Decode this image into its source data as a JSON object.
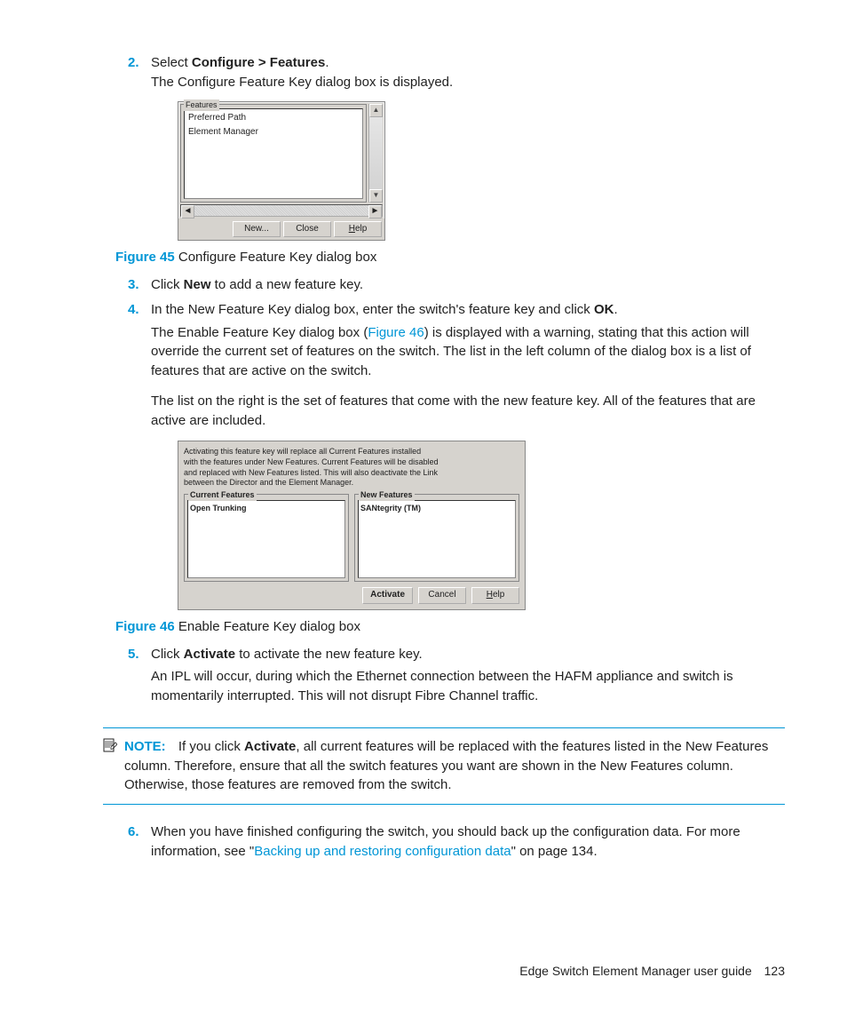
{
  "steps": {
    "s2": {
      "num": "2.",
      "line1_pre": "Select ",
      "line1_bold": "Configure > Features",
      "line1_post": ".",
      "line2": "The Configure Feature Key dialog box is displayed."
    },
    "s3": {
      "num": "3.",
      "pre": "Click ",
      "bold": "New",
      "post": " to add a new feature key."
    },
    "s4": {
      "num": "4.",
      "line1_pre": "In the New Feature Key dialog box, enter the switch's feature key and click ",
      "line1_bold": "OK",
      "line1_post": ".",
      "p1_pre": "The Enable Feature Key dialog box (",
      "p1_link": "Figure 46",
      "p1_post": ") is displayed with a warning, stating that this action will override the current set of features on the switch. The list in the left column of the dialog box is a list of features that are active on the switch.",
      "p2": "The list on the right is the set of features that come with the new feature key. All of the features that are active are included."
    },
    "s5": {
      "num": "5.",
      "line1_pre": "Click ",
      "line1_bold": "Activate",
      "line1_post": " to activate the new feature key.",
      "p1": "An IPL will occur, during which the Ethernet connection between the HAFM appliance and switch is momentarily interrupted. This will not disrupt Fibre Channel traffic."
    },
    "s6": {
      "num": "6.",
      "pre": "When you have finished configuring the switch, you should back up the configuration data. For more information, see \"",
      "link": "Backing up and restoring configuration data",
      "post": "\" on page 134."
    }
  },
  "figures": {
    "f45": {
      "label": "Figure 45",
      "caption": " Configure Feature Key dialog box"
    },
    "f46": {
      "label": "Figure 46",
      "caption": " Enable Feature Key dialog box"
    }
  },
  "dialog1": {
    "legend": "Features",
    "items": [
      "Preferred Path",
      "Element Manager"
    ],
    "buttons": {
      "new": "New...",
      "close": "Close",
      "help_pre": "H",
      "help_rest": "elp"
    }
  },
  "dialog2": {
    "warn1": "Activating this feature key will replace all Current Features installed",
    "warn2": "with the features under New Features. Current Features will be disabled",
    "warn3": "and replaced with New Features listed. This will also deactivate the Link",
    "warn4": "between the Director and the Element Manager.",
    "left_legend": "Current Features",
    "right_legend": "New Features",
    "left_item": "Open Trunking",
    "right_item": "SANtegrity (TM)",
    "buttons": {
      "activate": "Activate",
      "cancel": "Cancel",
      "help_pre": "H",
      "help_rest": "elp"
    }
  },
  "note": {
    "label": "NOTE:",
    "pre": "If you click ",
    "bold": "Activate",
    "post": ", all current features will be replaced with the features listed in the New Features column. Therefore, ensure that all the switch features you want are shown in the New Features column. Otherwise, those features are removed from the switch."
  },
  "footer": {
    "title": "Edge Switch Element Manager user guide",
    "page": "123"
  }
}
